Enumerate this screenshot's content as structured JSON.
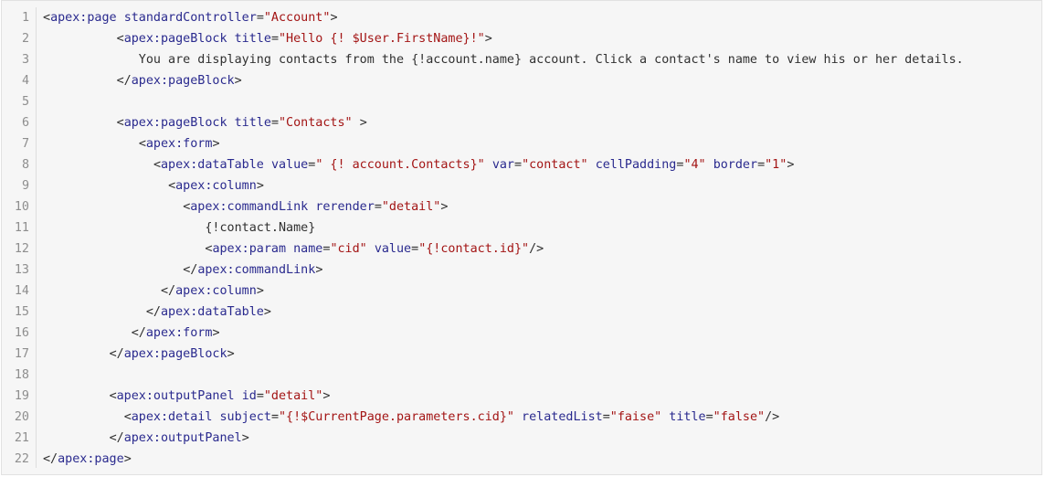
{
  "colors": {
    "background": "#f6f6f6",
    "border": "#e2e2e2",
    "line_number": "#8e8e8e",
    "tag": "#2a2a8e",
    "attribute": "#2a2a8e",
    "string": "#a31515",
    "text": "#303030"
  },
  "code": {
    "lines": [
      {
        "num": "1",
        "tokens": [
          {
            "t": "punct",
            "v": "<"
          },
          {
            "t": "tag",
            "v": "apex:page"
          },
          {
            "t": "txt",
            "v": " "
          },
          {
            "t": "attr",
            "v": "standardController"
          },
          {
            "t": "punct",
            "v": "="
          },
          {
            "t": "str",
            "v": "\"Account\""
          },
          {
            "t": "punct",
            "v": ">"
          }
        ]
      },
      {
        "num": "2",
        "tokens": [
          {
            "t": "txt",
            "v": "          "
          },
          {
            "t": "punct",
            "v": "<"
          },
          {
            "t": "tag",
            "v": "apex:pageBlock"
          },
          {
            "t": "txt",
            "v": " "
          },
          {
            "t": "attr",
            "v": "title"
          },
          {
            "t": "punct",
            "v": "="
          },
          {
            "t": "str",
            "v": "\"Hello {! $User.FirstName}!\""
          },
          {
            "t": "punct",
            "v": ">"
          }
        ]
      },
      {
        "num": "3",
        "tokens": [
          {
            "t": "txt",
            "v": "             You are displaying contacts from the {!account.name} account. Click a contact's name to view his or her details."
          }
        ]
      },
      {
        "num": "4",
        "tokens": [
          {
            "t": "txt",
            "v": "          "
          },
          {
            "t": "punct",
            "v": "</"
          },
          {
            "t": "tag",
            "v": "apex:pageBlock"
          },
          {
            "t": "punct",
            "v": ">"
          }
        ]
      },
      {
        "num": "5",
        "tokens": []
      },
      {
        "num": "6",
        "tokens": [
          {
            "t": "txt",
            "v": "          "
          },
          {
            "t": "punct",
            "v": "<"
          },
          {
            "t": "tag",
            "v": "apex:pageBlock"
          },
          {
            "t": "txt",
            "v": " "
          },
          {
            "t": "attr",
            "v": "title"
          },
          {
            "t": "punct",
            "v": "="
          },
          {
            "t": "str",
            "v": "\"Contacts\""
          },
          {
            "t": "txt",
            "v": " "
          },
          {
            "t": "punct",
            "v": ">"
          }
        ]
      },
      {
        "num": "7",
        "tokens": [
          {
            "t": "txt",
            "v": "             "
          },
          {
            "t": "punct",
            "v": "<"
          },
          {
            "t": "tag",
            "v": "apex:form"
          },
          {
            "t": "punct",
            "v": ">"
          }
        ]
      },
      {
        "num": "8",
        "tokens": [
          {
            "t": "txt",
            "v": "               "
          },
          {
            "t": "punct",
            "v": "<"
          },
          {
            "t": "tag",
            "v": "apex:dataTable"
          },
          {
            "t": "txt",
            "v": " "
          },
          {
            "t": "attr",
            "v": "value"
          },
          {
            "t": "punct",
            "v": "="
          },
          {
            "t": "str",
            "v": "\" {! account.Contacts}\""
          },
          {
            "t": "txt",
            "v": " "
          },
          {
            "t": "attr",
            "v": "var"
          },
          {
            "t": "punct",
            "v": "="
          },
          {
            "t": "str",
            "v": "\"contact\""
          },
          {
            "t": "txt",
            "v": " "
          },
          {
            "t": "attr",
            "v": "cellPadding"
          },
          {
            "t": "punct",
            "v": "="
          },
          {
            "t": "str",
            "v": "\"4\""
          },
          {
            "t": "txt",
            "v": " "
          },
          {
            "t": "attr",
            "v": "border"
          },
          {
            "t": "punct",
            "v": "="
          },
          {
            "t": "str",
            "v": "\"1\""
          },
          {
            "t": "punct",
            "v": ">"
          }
        ]
      },
      {
        "num": "9",
        "tokens": [
          {
            "t": "txt",
            "v": "                 "
          },
          {
            "t": "punct",
            "v": "<"
          },
          {
            "t": "tag",
            "v": "apex:column"
          },
          {
            "t": "punct",
            "v": ">"
          }
        ]
      },
      {
        "num": "10",
        "tokens": [
          {
            "t": "txt",
            "v": "                   "
          },
          {
            "t": "punct",
            "v": "<"
          },
          {
            "t": "tag",
            "v": "apex:commandLink"
          },
          {
            "t": "txt",
            "v": " "
          },
          {
            "t": "attr",
            "v": "rerender"
          },
          {
            "t": "punct",
            "v": "="
          },
          {
            "t": "str",
            "v": "\"detail\""
          },
          {
            "t": "punct",
            "v": ">"
          }
        ]
      },
      {
        "num": "11",
        "tokens": [
          {
            "t": "txt",
            "v": "                      {!contact.Name}"
          }
        ]
      },
      {
        "num": "12",
        "tokens": [
          {
            "t": "txt",
            "v": "                      "
          },
          {
            "t": "punct",
            "v": "<"
          },
          {
            "t": "tag",
            "v": "apex:param"
          },
          {
            "t": "txt",
            "v": " "
          },
          {
            "t": "attr",
            "v": "name"
          },
          {
            "t": "punct",
            "v": "="
          },
          {
            "t": "str",
            "v": "\"cid\""
          },
          {
            "t": "txt",
            "v": " "
          },
          {
            "t": "attr",
            "v": "value"
          },
          {
            "t": "punct",
            "v": "="
          },
          {
            "t": "str",
            "v": "\"{!contact.id}\""
          },
          {
            "t": "punct",
            "v": "/>"
          }
        ]
      },
      {
        "num": "13",
        "tokens": [
          {
            "t": "txt",
            "v": "                   "
          },
          {
            "t": "punct",
            "v": "</"
          },
          {
            "t": "tag",
            "v": "apex:commandLink"
          },
          {
            "t": "punct",
            "v": ">"
          }
        ]
      },
      {
        "num": "14",
        "tokens": [
          {
            "t": "txt",
            "v": "                "
          },
          {
            "t": "punct",
            "v": "</"
          },
          {
            "t": "tag",
            "v": "apex:column"
          },
          {
            "t": "punct",
            "v": ">"
          }
        ]
      },
      {
        "num": "15",
        "tokens": [
          {
            "t": "txt",
            "v": "              "
          },
          {
            "t": "punct",
            "v": "</"
          },
          {
            "t": "tag",
            "v": "apex:dataTable"
          },
          {
            "t": "punct",
            "v": ">"
          }
        ]
      },
      {
        "num": "16",
        "tokens": [
          {
            "t": "txt",
            "v": "            "
          },
          {
            "t": "punct",
            "v": "</"
          },
          {
            "t": "tag",
            "v": "apex:form"
          },
          {
            "t": "punct",
            "v": ">"
          }
        ]
      },
      {
        "num": "17",
        "tokens": [
          {
            "t": "txt",
            "v": "         "
          },
          {
            "t": "punct",
            "v": "</"
          },
          {
            "t": "tag",
            "v": "apex:pageBlock"
          },
          {
            "t": "punct",
            "v": ">"
          }
        ]
      },
      {
        "num": "18",
        "tokens": []
      },
      {
        "num": "19",
        "tokens": [
          {
            "t": "txt",
            "v": "         "
          },
          {
            "t": "punct",
            "v": "<"
          },
          {
            "t": "tag",
            "v": "apex:outputPanel"
          },
          {
            "t": "txt",
            "v": " "
          },
          {
            "t": "attr",
            "v": "id"
          },
          {
            "t": "punct",
            "v": "="
          },
          {
            "t": "str",
            "v": "\"detail\""
          },
          {
            "t": "punct",
            "v": ">"
          }
        ]
      },
      {
        "num": "20",
        "tokens": [
          {
            "t": "txt",
            "v": "           "
          },
          {
            "t": "punct",
            "v": "<"
          },
          {
            "t": "tag",
            "v": "apex:detail"
          },
          {
            "t": "txt",
            "v": " "
          },
          {
            "t": "attr",
            "v": "subject"
          },
          {
            "t": "punct",
            "v": "="
          },
          {
            "t": "str",
            "v": "\"{!$CurrentPage.parameters.cid}\""
          },
          {
            "t": "txt",
            "v": " "
          },
          {
            "t": "attr",
            "v": "relatedList"
          },
          {
            "t": "punct",
            "v": "="
          },
          {
            "t": "str",
            "v": "\"faise\""
          },
          {
            "t": "txt",
            "v": " "
          },
          {
            "t": "attr",
            "v": "title"
          },
          {
            "t": "punct",
            "v": "="
          },
          {
            "t": "str",
            "v": "\"false\""
          },
          {
            "t": "punct",
            "v": "/>"
          }
        ]
      },
      {
        "num": "21",
        "tokens": [
          {
            "t": "txt",
            "v": "         "
          },
          {
            "t": "punct",
            "v": "</"
          },
          {
            "t": "tag",
            "v": "apex:outputPanel"
          },
          {
            "t": "punct",
            "v": ">"
          }
        ]
      },
      {
        "num": "22",
        "tokens": [
          {
            "t": "punct",
            "v": "</"
          },
          {
            "t": "tag",
            "v": "apex:page"
          },
          {
            "t": "punct",
            "v": ">"
          }
        ]
      }
    ]
  }
}
